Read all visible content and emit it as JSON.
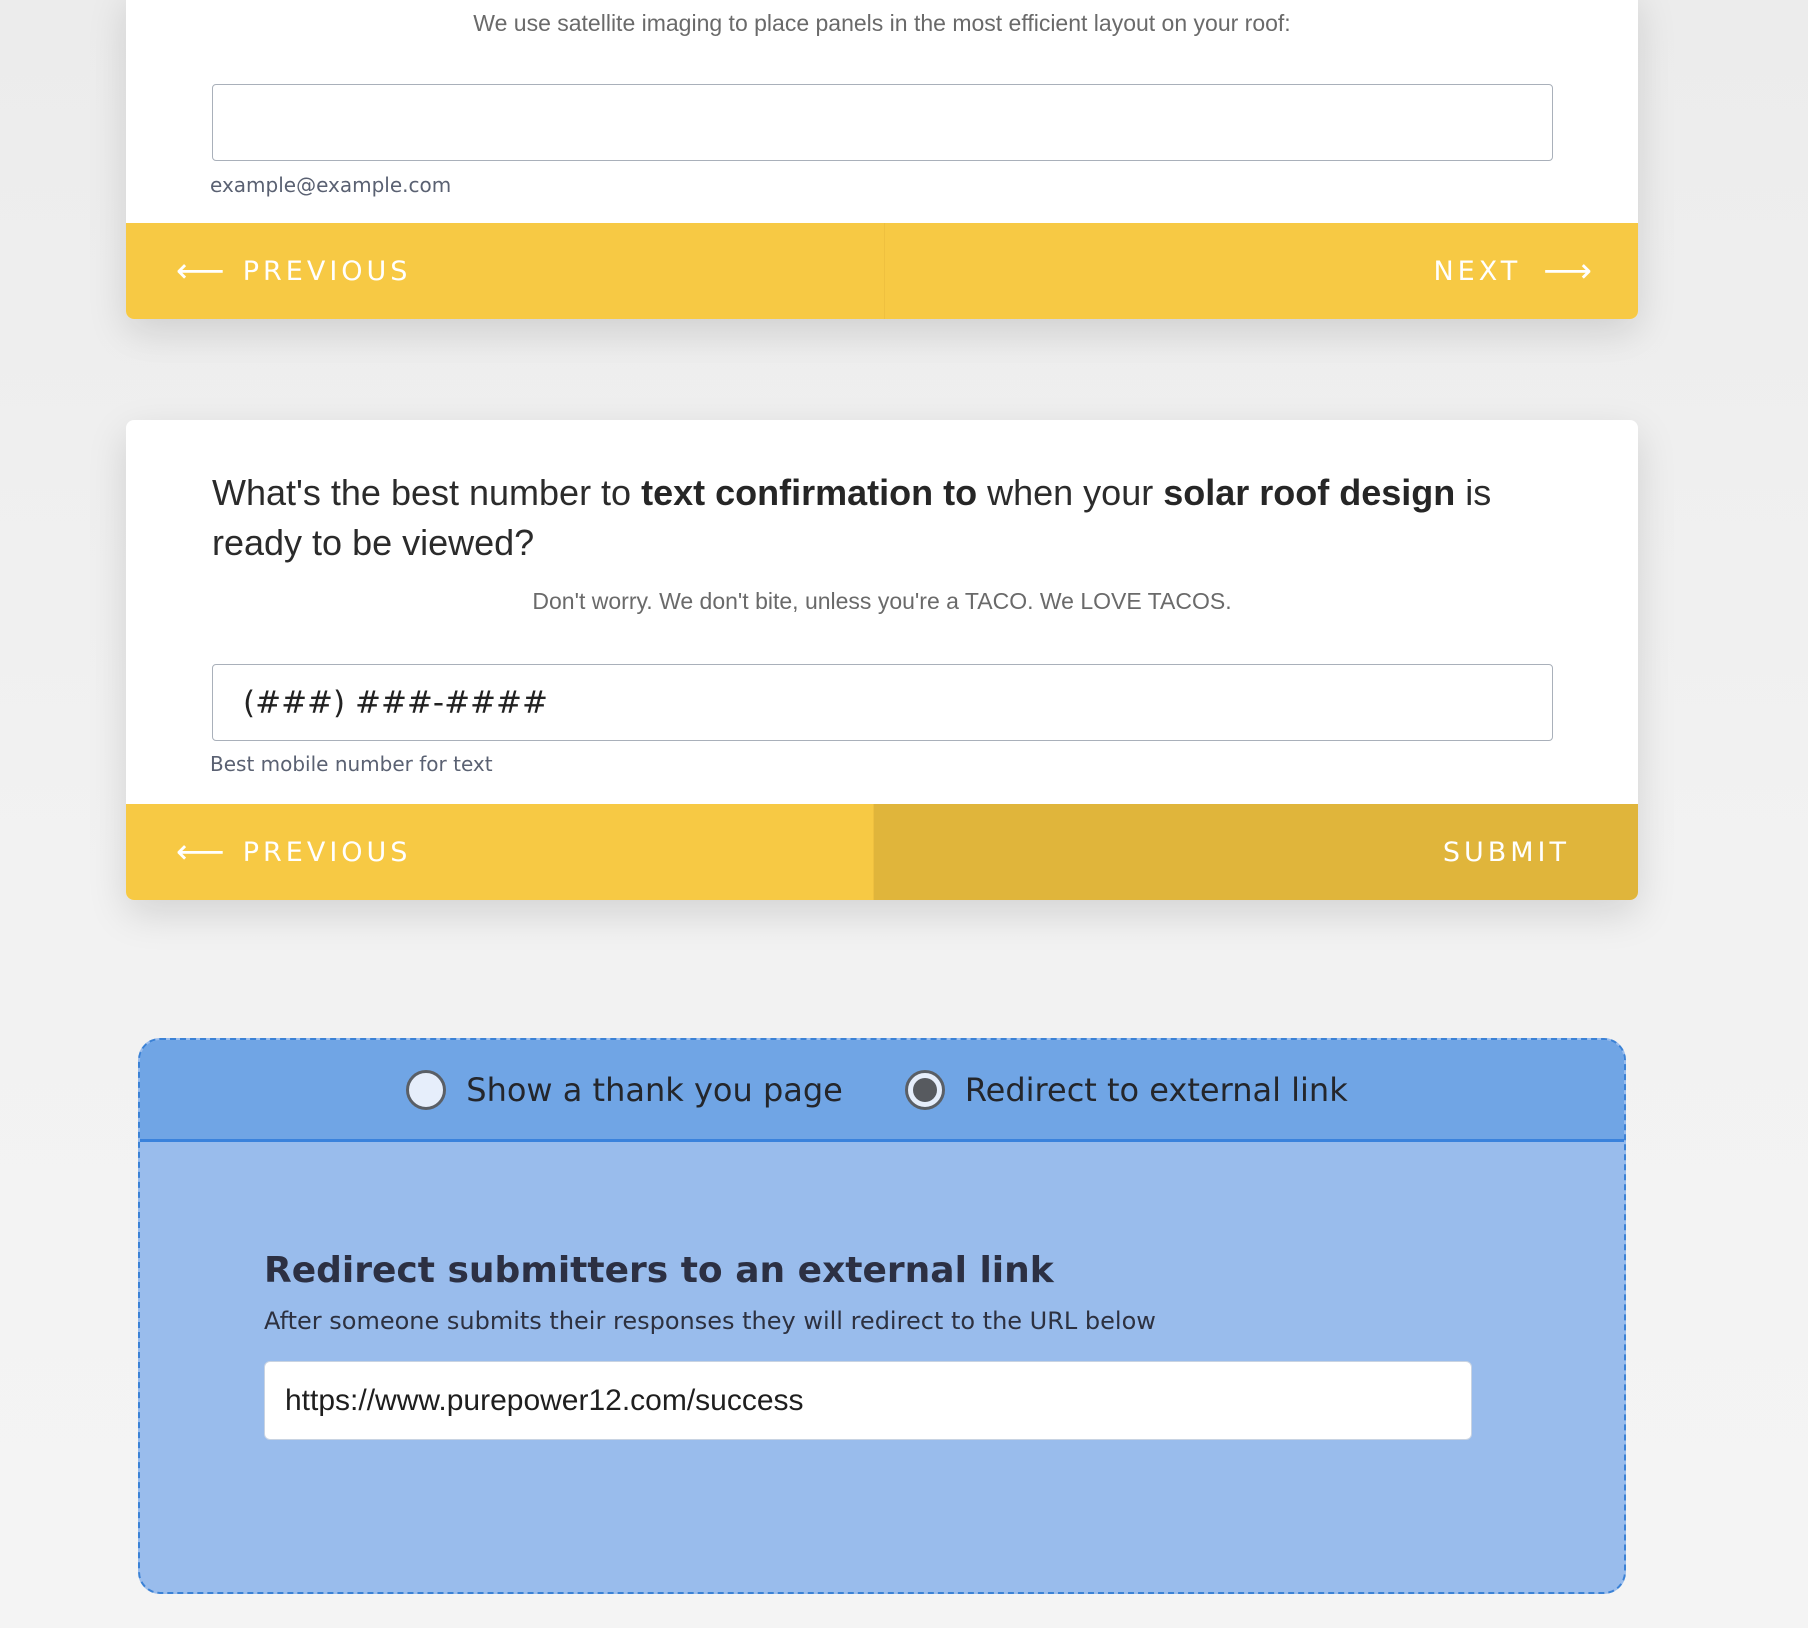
{
  "email_card": {
    "subtext": "We use satellite imaging to place panels in the most efficient layout on your roof:",
    "input_value": "",
    "helper": "example@example.com",
    "previous_label": "PREVIOUS",
    "next_label": "NEXT"
  },
  "phone_card": {
    "question": {
      "part1": "What's the best number to ",
      "bold1": "text confirmation to",
      "part2": " when your ",
      "bold2": "solar roof design",
      "part3": " is ready to be viewed?"
    },
    "subtext": "Don't worry.  We don't bite, unless you're a TACO.  We LOVE TACOS.",
    "input_value": "(###) ###-####",
    "helper": "Best mobile number for text",
    "previous_label": "PREVIOUS",
    "submit_label": "SUBMIT"
  },
  "redirect_panel": {
    "options": [
      {
        "label": "Show a thank you page",
        "checked": false
      },
      {
        "label": "Redirect to external link",
        "checked": true
      }
    ],
    "title": "Redirect submitters to an external link",
    "description": "After someone submits their responses they will redirect to the URL below",
    "url_value": "https://www.purepower12.com/success"
  },
  "colors": {
    "nav_yellow": "#f7c944",
    "submit_yellow": "#e0b53b",
    "panel_header_blue": "#70a5e5",
    "panel_body_blue": "#99bcec",
    "panel_border_blue": "#3b82d6"
  },
  "icons": {
    "previous": "arrow-left-icon",
    "next": "arrow-right-icon"
  }
}
